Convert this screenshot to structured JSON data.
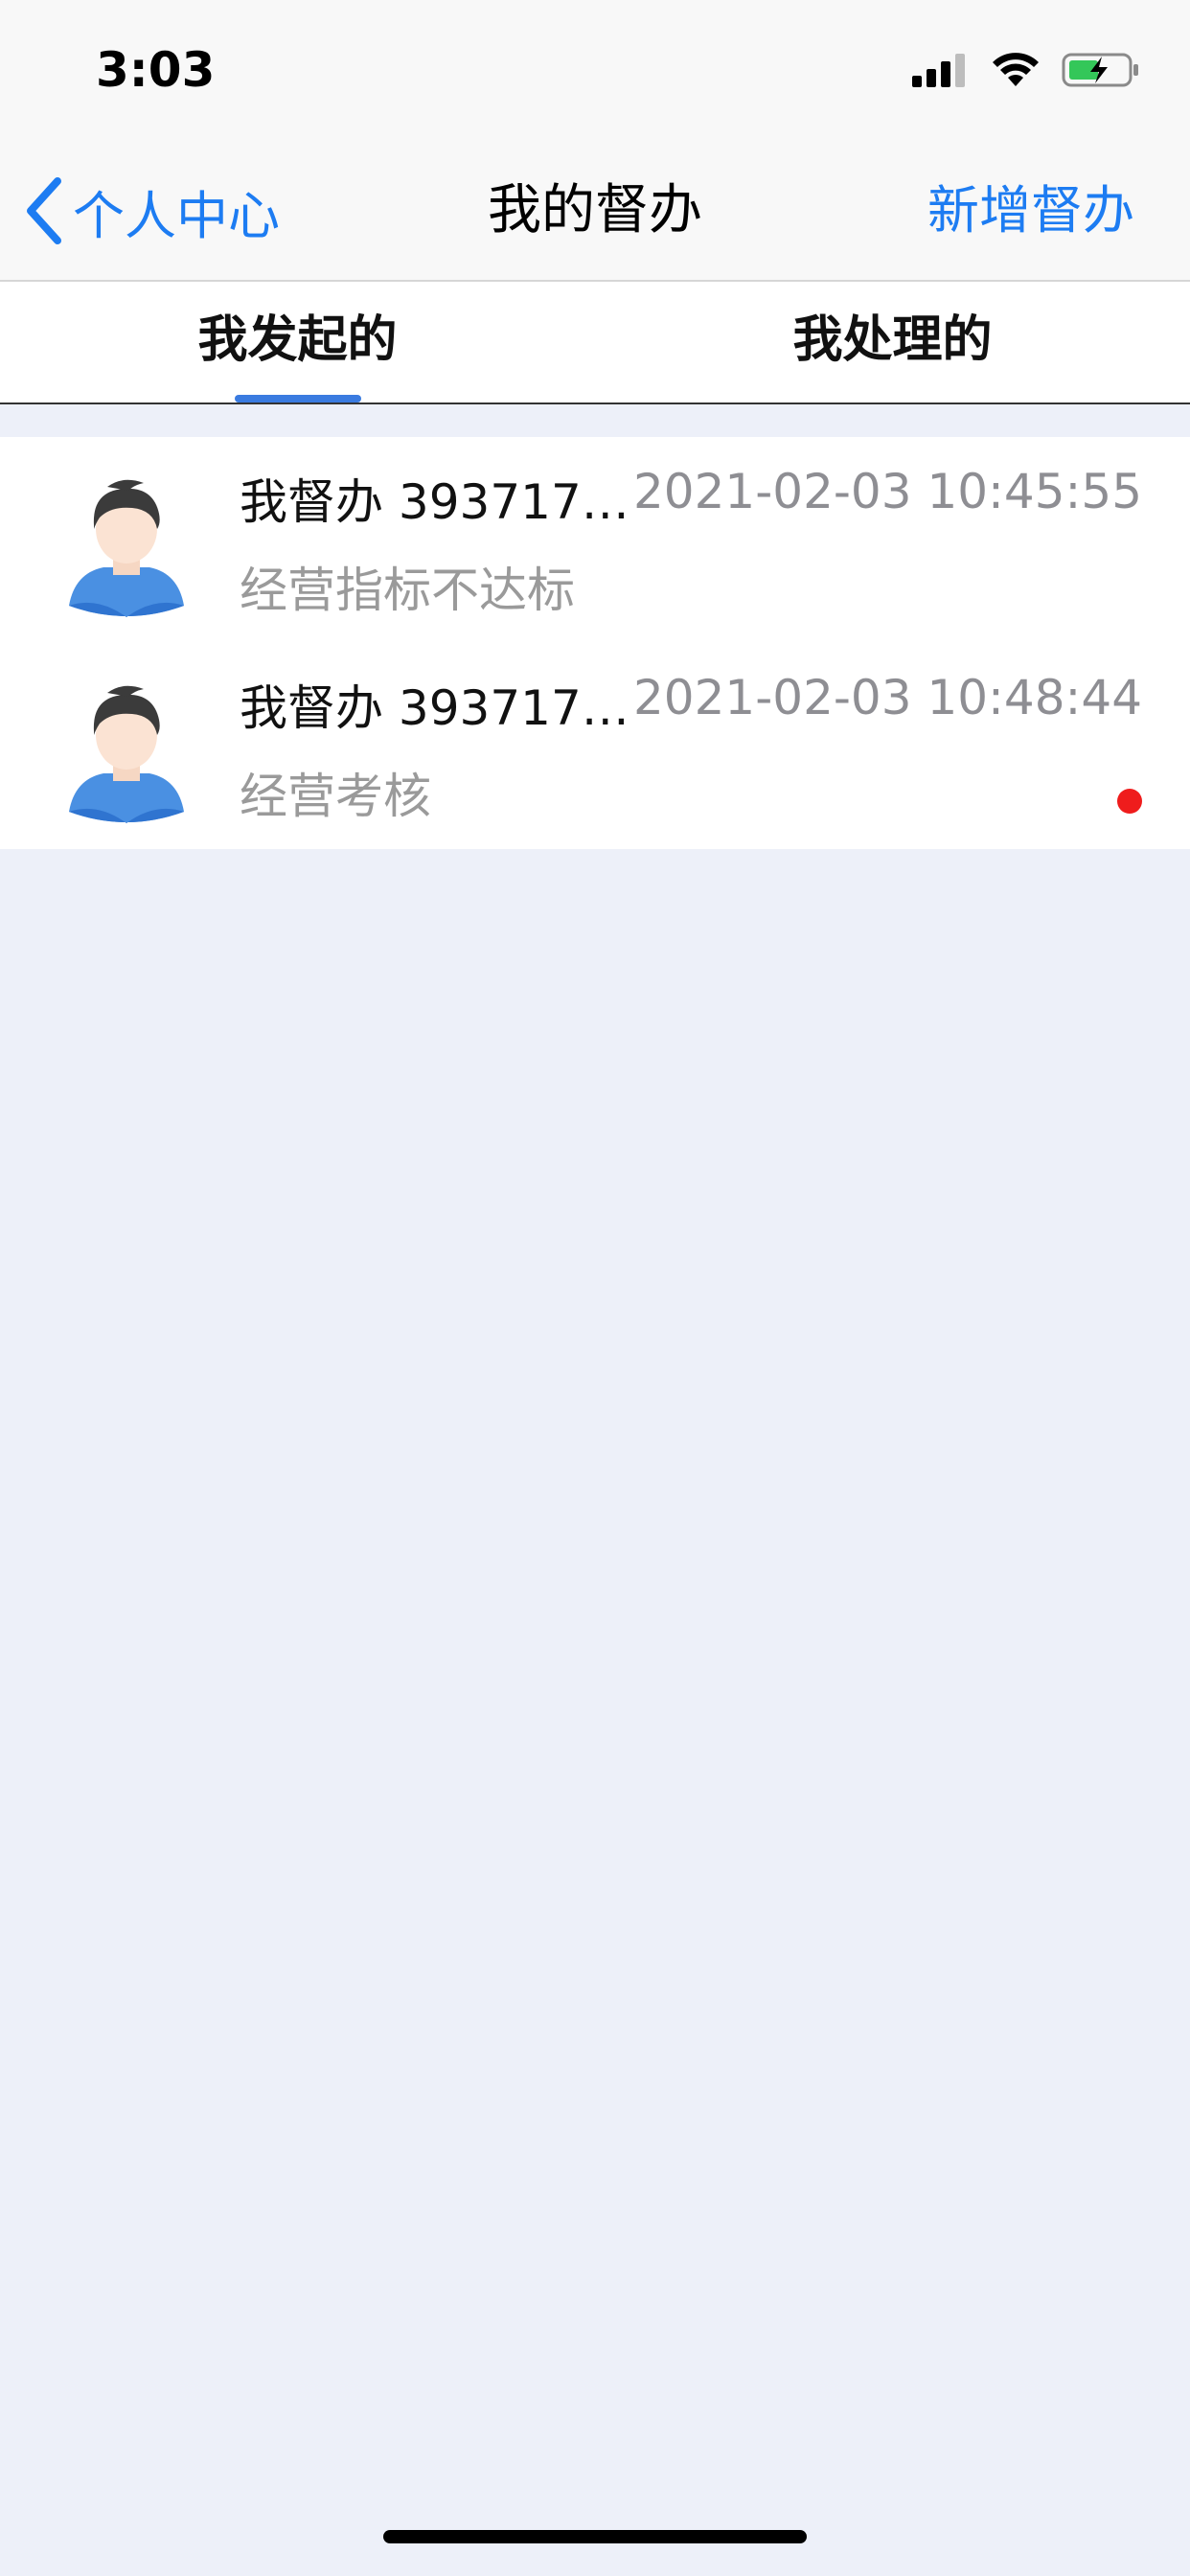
{
  "status_bar": {
    "time": "3:03",
    "icons": [
      "signal-icon",
      "wifi-icon",
      "battery-charging-icon"
    ]
  },
  "nav": {
    "back_label": "个人中心",
    "title": "我的督办",
    "action_label": "新增督办",
    "accent_color": "#1d7cf2"
  },
  "tabs": [
    {
      "label": "我发起的",
      "active": true
    },
    {
      "label": "我处理的",
      "active": false
    }
  ],
  "items": [
    {
      "title": "我督办 39371703...",
      "time": "2021-02-03 10:45:55",
      "subtitle": "经营指标不达标",
      "unread": false
    },
    {
      "title": "我督办 39371703...",
      "time": "2021-02-03 10:48:44",
      "subtitle": "经营考核",
      "unread": true
    }
  ],
  "colors": {
    "background": "#edf0f9",
    "tab_indicator": "#3a7be0",
    "unread_dot": "#ef1c1c",
    "secondary_text": "#8e8e93"
  }
}
